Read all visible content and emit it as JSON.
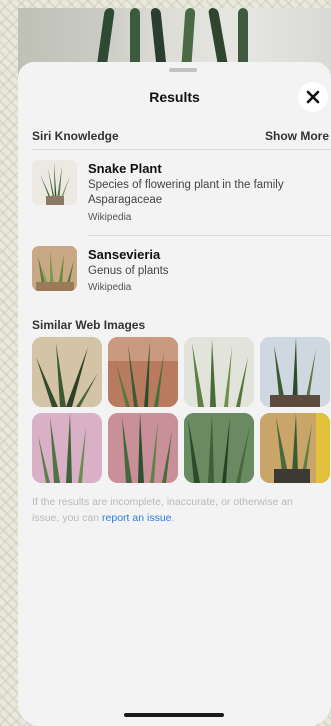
{
  "sheet": {
    "title": "Results"
  },
  "siri_knowledge": {
    "header": "Siri Knowledge",
    "show_more": "Show More",
    "results": [
      {
        "title": "Snake Plant",
        "description": "Species of flowering plant in the family Asparagaceae",
        "source": "Wikipedia"
      },
      {
        "title": "Sansevieria",
        "description": "Genus of plants",
        "source": "Wikipedia"
      }
    ]
  },
  "similar_web_images": {
    "header": "Similar Web Images"
  },
  "footer": {
    "disclaimer_prefix": "If the results are incomplete, inaccurate, or otherwise an issue, you can ",
    "report_link": "report an issue",
    "disclaimer_suffix": "."
  },
  "icons": {
    "close": "close-icon"
  },
  "colors": {
    "link": "#2a7de1",
    "sheet_bg": "#f3f3f3"
  }
}
